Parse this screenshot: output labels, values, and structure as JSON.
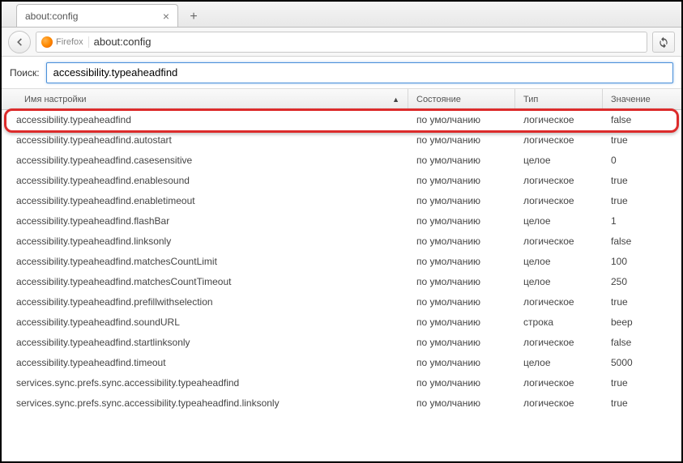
{
  "tab": {
    "title": "about:config"
  },
  "url": {
    "identity": "Firefox",
    "address": "about:config"
  },
  "search": {
    "label": "Поиск:",
    "value": "accessibility.typeaheadfind"
  },
  "columns": {
    "name": "Имя настройки",
    "state": "Состояние",
    "type": "Тип",
    "value": "Значение"
  },
  "rows": [
    {
      "name": "accessibility.typeaheadfind",
      "state": "по умолчанию",
      "type": "логическое",
      "value": "false"
    },
    {
      "name": "accessibility.typeaheadfind.autostart",
      "state": "по умолчанию",
      "type": "логическое",
      "value": "true"
    },
    {
      "name": "accessibility.typeaheadfind.casesensitive",
      "state": "по умолчанию",
      "type": "целое",
      "value": "0"
    },
    {
      "name": "accessibility.typeaheadfind.enablesound",
      "state": "по умолчанию",
      "type": "логическое",
      "value": "true"
    },
    {
      "name": "accessibility.typeaheadfind.enabletimeout",
      "state": "по умолчанию",
      "type": "логическое",
      "value": "true"
    },
    {
      "name": "accessibility.typeaheadfind.flashBar",
      "state": "по умолчанию",
      "type": "целое",
      "value": "1"
    },
    {
      "name": "accessibility.typeaheadfind.linksonly",
      "state": "по умолчанию",
      "type": "логическое",
      "value": "false"
    },
    {
      "name": "accessibility.typeaheadfind.matchesCountLimit",
      "state": "по умолчанию",
      "type": "целое",
      "value": "100"
    },
    {
      "name": "accessibility.typeaheadfind.matchesCountTimeout",
      "state": "по умолчанию",
      "type": "целое",
      "value": "250"
    },
    {
      "name": "accessibility.typeaheadfind.prefillwithselection",
      "state": "по умолчанию",
      "type": "логическое",
      "value": "true"
    },
    {
      "name": "accessibility.typeaheadfind.soundURL",
      "state": "по умолчанию",
      "type": "строка",
      "value": "beep"
    },
    {
      "name": "accessibility.typeaheadfind.startlinksonly",
      "state": "по умолчанию",
      "type": "логическое",
      "value": "false"
    },
    {
      "name": "accessibility.typeaheadfind.timeout",
      "state": "по умолчанию",
      "type": "целое",
      "value": "5000"
    },
    {
      "name": "services.sync.prefs.sync.accessibility.typeaheadfind",
      "state": "по умолчанию",
      "type": "логическое",
      "value": "true"
    },
    {
      "name": "services.sync.prefs.sync.accessibility.typeaheadfind.linksonly",
      "state": "по умолчанию",
      "type": "логическое",
      "value": "true"
    }
  ]
}
